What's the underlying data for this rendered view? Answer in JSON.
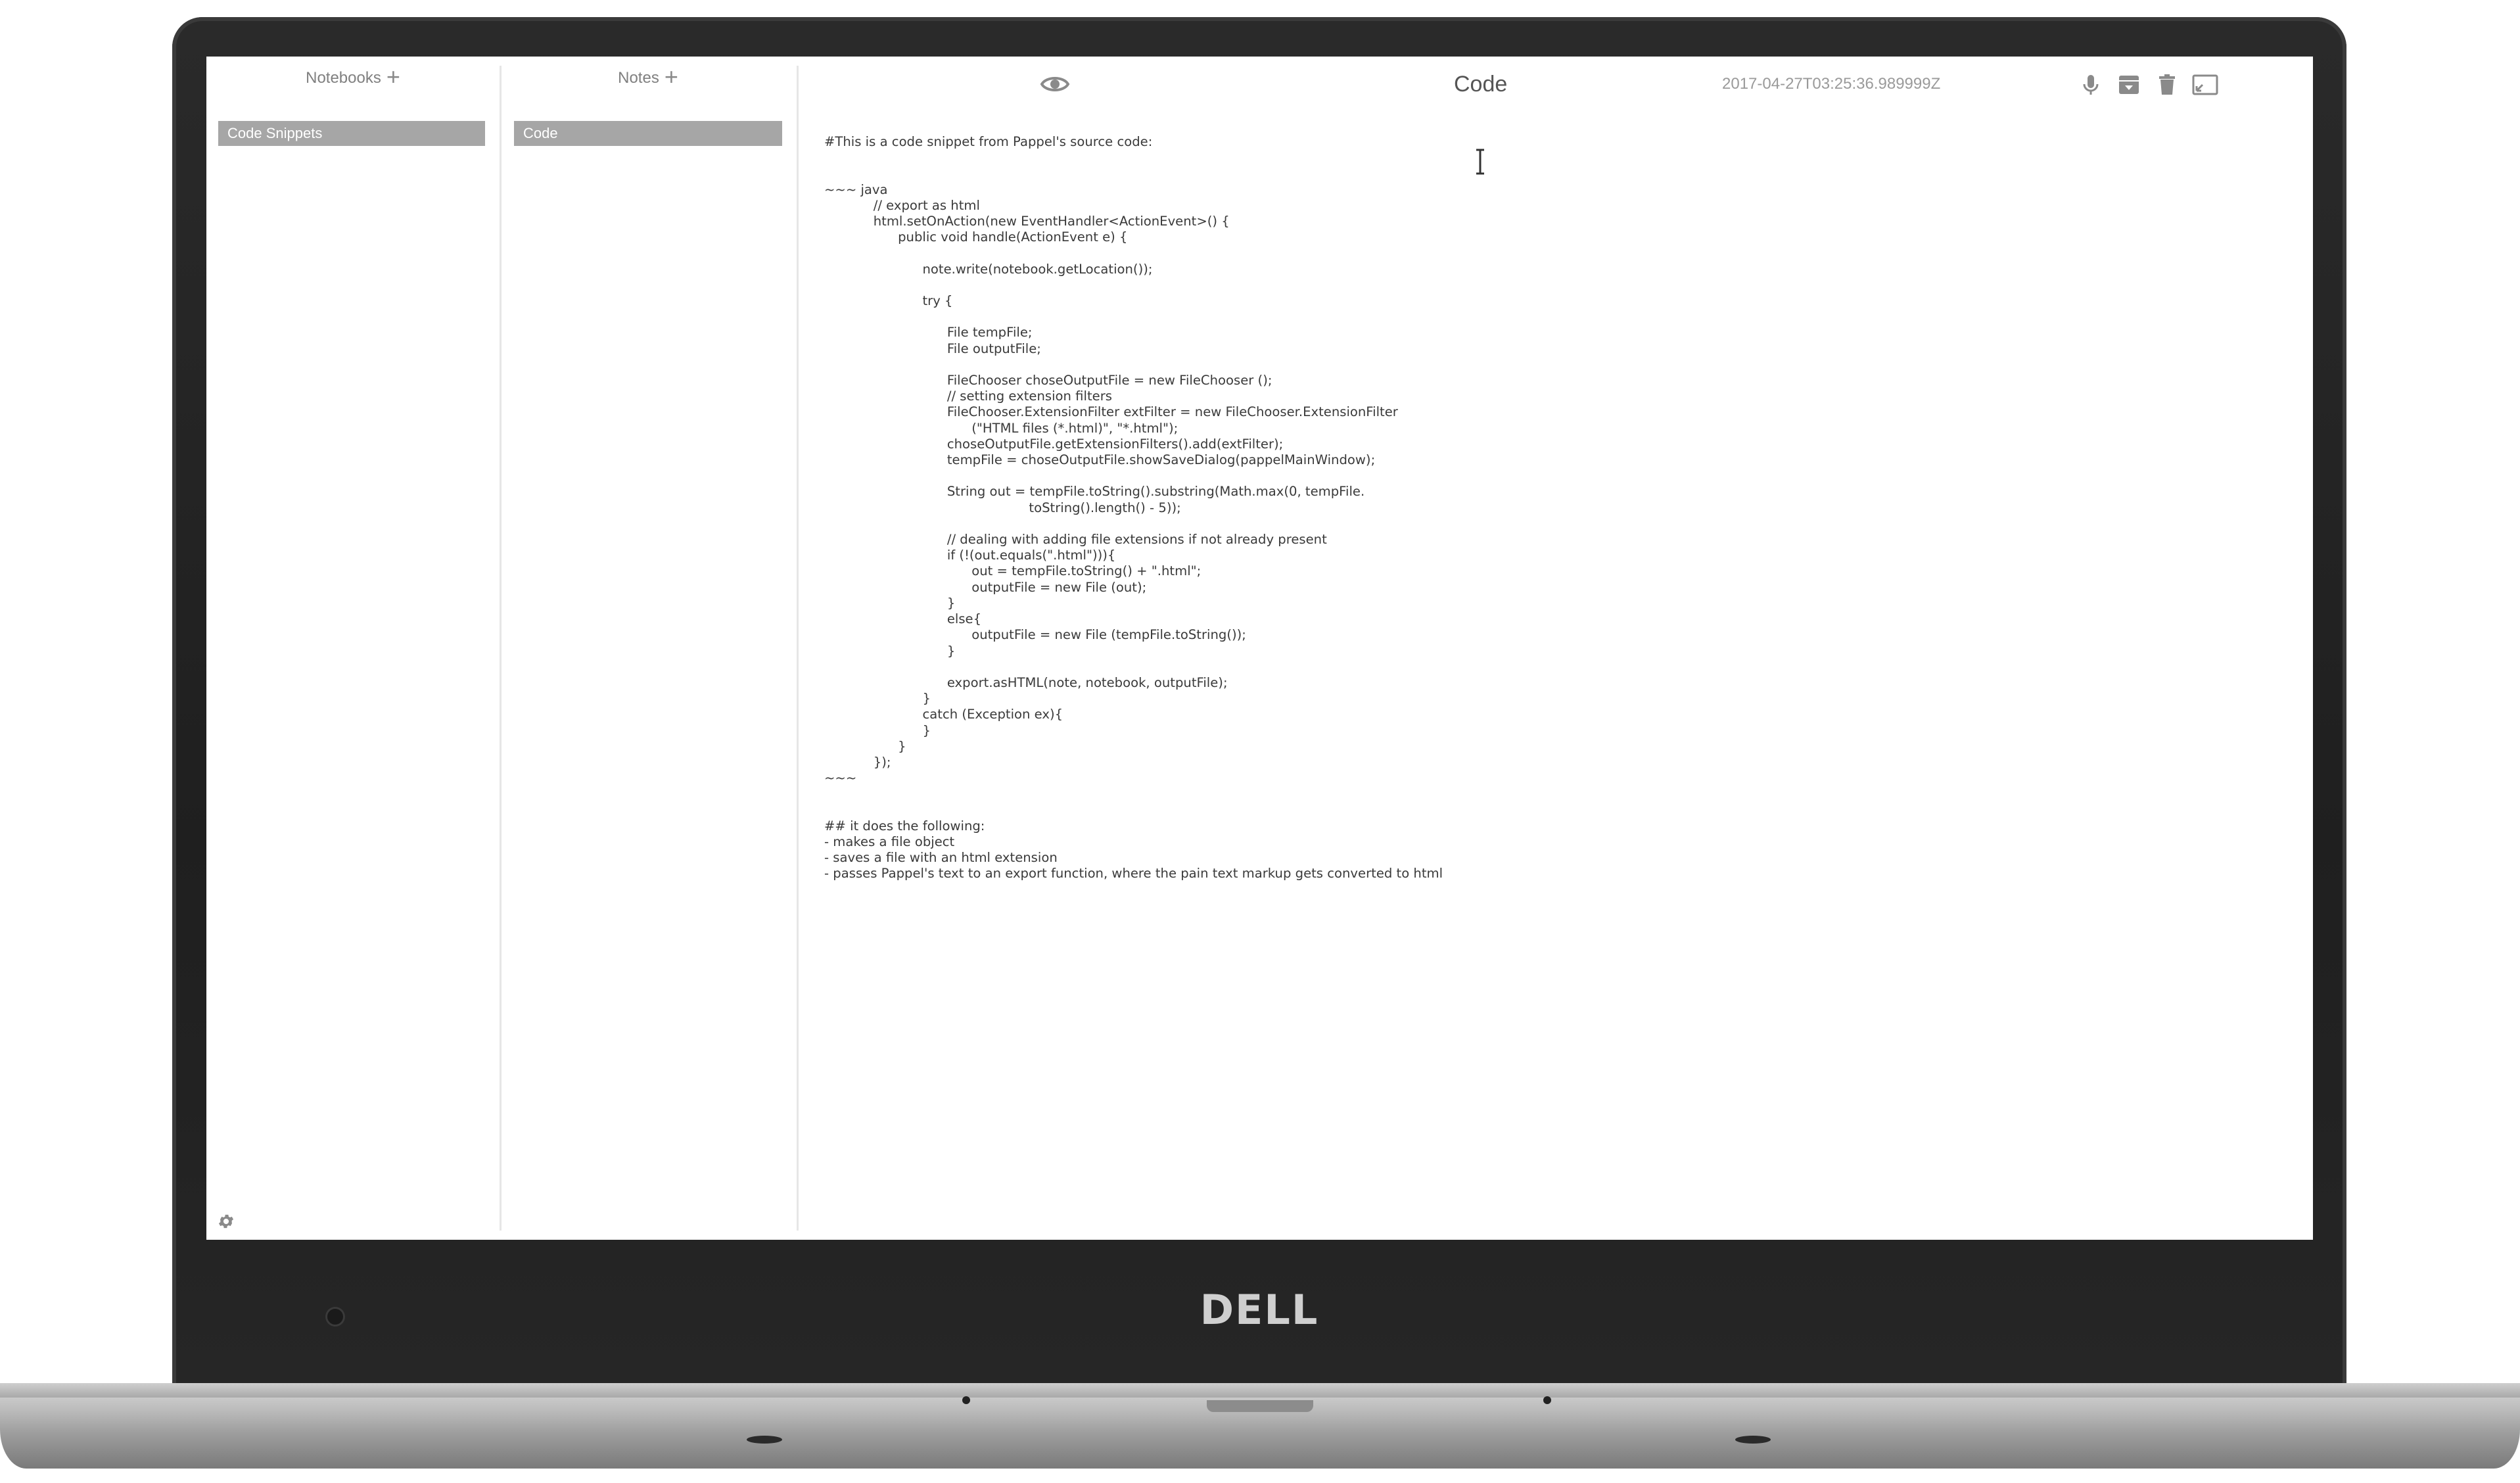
{
  "device": {
    "brand_logo": "DELL"
  },
  "notebooks_panel": {
    "header": "Notebooks",
    "add_label": "+",
    "items": [
      {
        "label": "Code Snippets",
        "selected": true
      }
    ]
  },
  "notes_panel": {
    "header": "Notes",
    "add_label": "+",
    "items": [
      {
        "label": "Code",
        "selected": true
      }
    ]
  },
  "editor": {
    "title": "Code",
    "timestamp": "2017-04-27T03:25:36.989999Z",
    "toolbar_icons": [
      "eye-icon",
      "microphone-icon",
      "archive-icon",
      "trash-icon",
      "fullscreen-icon"
    ],
    "content": "#This is a code snippet from Pappel's source code:\n\n\n~~~ java\n            // export as html\n            html.setOnAction(new EventHandler<ActionEvent>() {\n                  public void handle(ActionEvent e) {\n\n                        note.write(notebook.getLocation());\n\n                        try {\n\n                              File tempFile;\n                              File outputFile;\n\n                              FileChooser choseOutputFile = new FileChooser ();\n                              // setting extension filters\n                              FileChooser.ExtensionFilter extFilter = new FileChooser.ExtensionFilter\n                                    (\"HTML files (*.html)\", \"*.html\");\n                              choseOutputFile.getExtensionFilters().add(extFilter);\n                              tempFile = choseOutputFile.showSaveDialog(pappelMainWindow);\n\n                              String out = tempFile.toString().substring(Math.max(0, tempFile.\n                                                  toString().length() - 5));\n\n                              // dealing with adding file extensions if not already present\n                              if (!(out.equals(\".html\"))){\n                                    out = tempFile.toString() + \".html\";\n                                    outputFile = new File (out);\n                              }\n                              else{\n                                    outputFile = new File (tempFile.toString());\n                              }\n\n                              export.asHTML(note, notebook, outputFile);\n                        }\n                        catch (Exception ex){\n                        }\n                  }\n            });\n~~~\n\n\n## it does the following:\n- makes a file object\n- saves a file with an html extension\n- passes Pappel's text to an export function, where the pain text markup gets converted to html"
  },
  "colors": {
    "selected_item_bg": "#a6a6a6",
    "selected_item_text": "#ffffff",
    "header_text": "#808080",
    "icon": "#8a8a8a",
    "divider": "#e6e6e6",
    "bezel": "#222222"
  }
}
